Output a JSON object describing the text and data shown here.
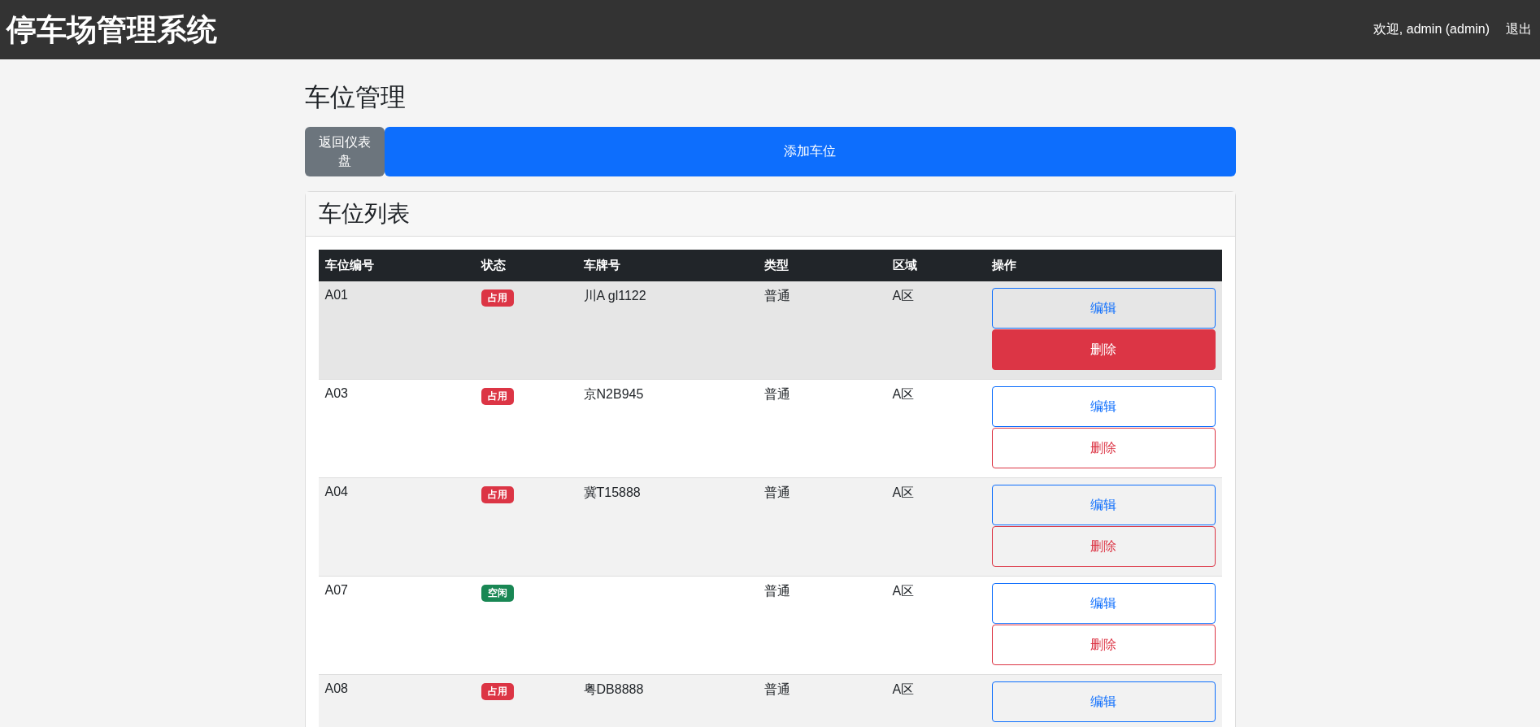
{
  "navbar": {
    "brand": "停车场管理系统",
    "welcome": "欢迎, admin (admin)",
    "logout": "退出"
  },
  "page_title": "车位管理",
  "toolbar": [
    {
      "label": "返回仪表盘",
      "kind": "secondary"
    },
    {
      "label": "添加车位",
      "kind": "primary"
    }
  ],
  "card": {
    "title": "车位列表",
    "table": {
      "columns": [
        "车位编号",
        "状态",
        "车牌号",
        "类型",
        "区域",
        "操作"
      ],
      "rows": [
        {
          "id": "A01",
          "status": {
            "label": "占用",
            "kind": "occupied"
          },
          "plate": "川A gl1122",
          "type": "普通",
          "zone": "A区",
          "highlighted": true,
          "actions": [
            {
              "label": "编辑",
              "kind": "edit",
              "active": false
            },
            {
              "label": "删除",
              "kind": "delete",
              "active": true
            }
          ]
        },
        {
          "id": "A03",
          "status": {
            "label": "占用",
            "kind": "occupied"
          },
          "plate": "京N2B945",
          "type": "普通",
          "zone": "A区",
          "highlighted": false,
          "actions": [
            {
              "label": "编辑",
              "kind": "edit",
              "active": false
            },
            {
              "label": "删除",
              "kind": "delete",
              "active": false
            }
          ]
        },
        {
          "id": "A04",
          "status": {
            "label": "占用",
            "kind": "occupied"
          },
          "plate": "冀T15888",
          "type": "普通",
          "zone": "A区",
          "highlighted": false,
          "actions": [
            {
              "label": "编辑",
              "kind": "edit",
              "active": false
            },
            {
              "label": "删除",
              "kind": "delete",
              "active": false
            }
          ]
        },
        {
          "id": "A07",
          "status": {
            "label": "空闲",
            "kind": "free"
          },
          "type": "普通",
          "zone": "A区",
          "highlighted": false,
          "actions": [
            {
              "label": "编辑",
              "kind": "edit",
              "active": false
            },
            {
              "label": "删除",
              "kind": "delete",
              "active": false
            }
          ]
        },
        {
          "id": "A08",
          "status": {
            "label": "占用",
            "kind": "occupied"
          },
          "plate": "粤DB8888",
          "type": "普通",
          "zone": "A区",
          "highlighted": false,
          "actions": [
            {
              "label": "编辑",
              "kind": "edit",
              "active": false
            }
          ]
        }
      ]
    }
  }
}
